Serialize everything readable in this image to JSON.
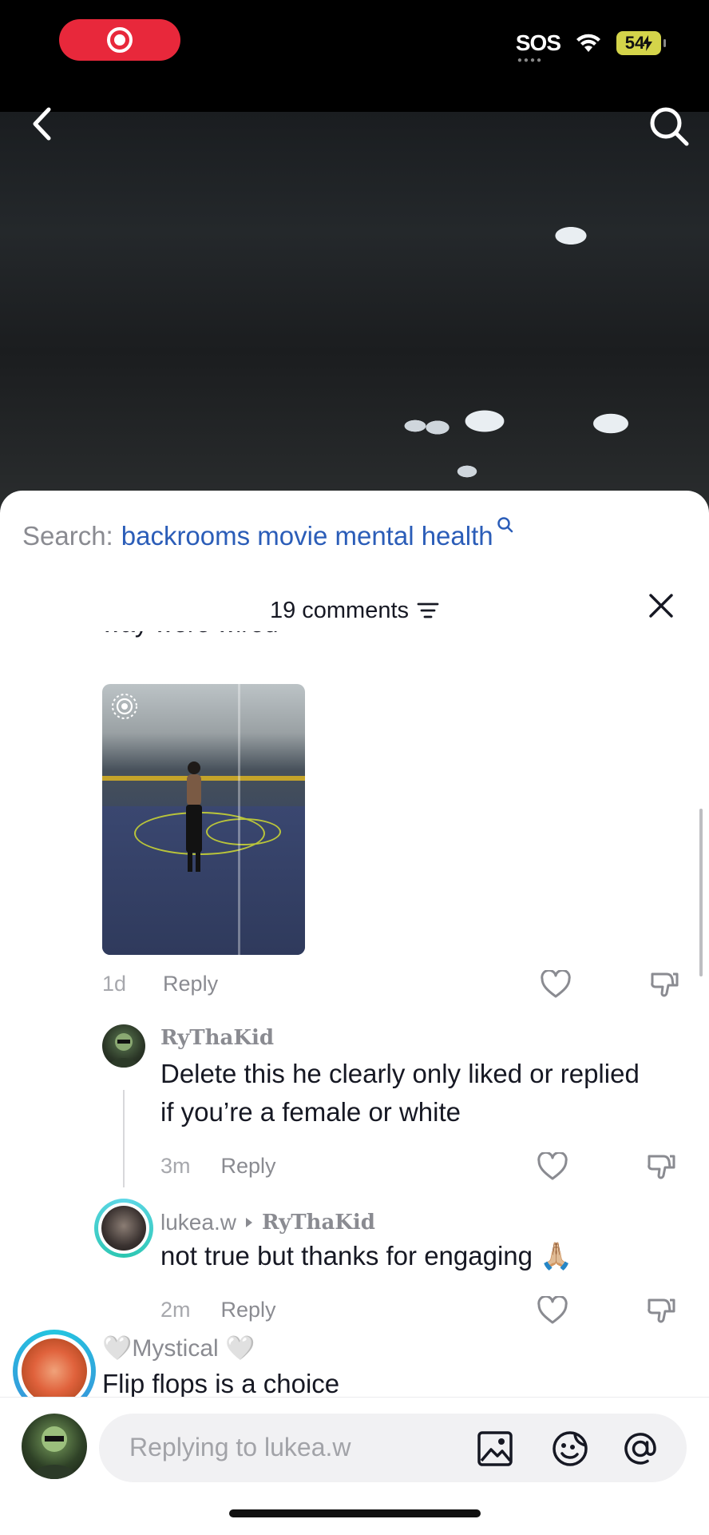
{
  "status_bar": {
    "sos": "SOS",
    "battery": "54"
  },
  "video": {
    "back_icon": "chevron-left-icon",
    "search_icon": "search-icon"
  },
  "search_suggestion": {
    "prefix": "Search:",
    "query": "backrooms movie mental health"
  },
  "comments_header": {
    "count_label": "19 comments"
  },
  "comments": [
    {
      "partial_text": "way were wired",
      "time": "1d",
      "reply_label": "Reply"
    },
    {
      "user": "RyThaKid",
      "text_line1": "Delete this he clearly only liked or replied",
      "text_line2": "if you’re a female or white",
      "time": "3m",
      "reply_label": "Reply"
    },
    {
      "user": "lukea.w",
      "reply_to": "RyThaKid",
      "text": "not true but thanks for engaging 🙏🏼",
      "time": "2m",
      "reply_label": "Reply"
    },
    {
      "user": "🤍Mystical 🤍",
      "text": "Flip flops is a choice"
    }
  ],
  "composer": {
    "placeholder": "Replying to lukea.w"
  },
  "colors": {
    "accent_link": "#2b5db8",
    "record_pill": "#e8283b",
    "battery": "#d4d44a"
  }
}
